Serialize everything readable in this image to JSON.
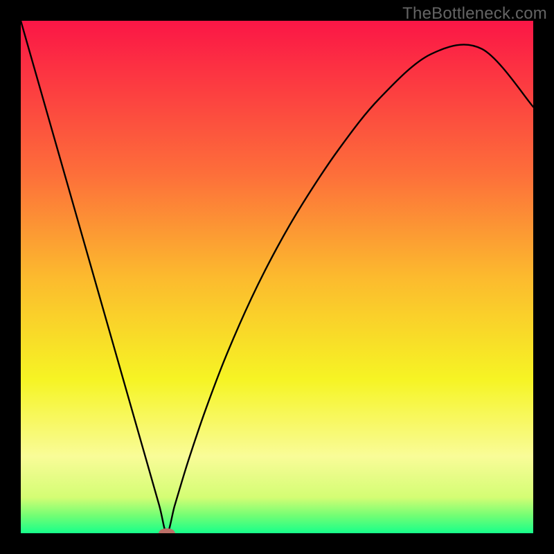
{
  "watermark": "TheBottleneck.com",
  "chart_data": {
    "type": "line",
    "title": "",
    "xlabel": "",
    "ylabel": "",
    "xlim": [
      0,
      100
    ],
    "ylim": [
      0,
      100
    ],
    "grid": false,
    "legend": false,
    "series": [
      {
        "name": "curve",
        "x": [
          0,
          3,
          6,
          9,
          12,
          15,
          18,
          21,
          24,
          27,
          28.5,
          30,
          31.5,
          33,
          36,
          40,
          45,
          50,
          55,
          62,
          70,
          80,
          90,
          100
        ],
        "y": [
          100,
          89.5,
          79,
          68.5,
          58,
          47.5,
          37,
          26.5,
          16,
          5.5,
          0,
          5.28,
          10.31,
          15.11,
          23.93,
          34.45,
          45.85,
          55.71,
          64.33,
          74.85,
          84.85,
          93.47,
          94.5,
          83.2
        ]
      }
    ],
    "marker": {
      "name": "bottleneck-point",
      "x": 28.5,
      "y": 0,
      "color": "#bc6f67"
    },
    "background": {
      "type": "vertical-gradient",
      "stops": [
        {
          "pos": 0.0,
          "color": "#fb1646"
        },
        {
          "pos": 0.3,
          "color": "#fd6f3a"
        },
        {
          "pos": 0.5,
          "color": "#fcba2e"
        },
        {
          "pos": 0.7,
          "color": "#f6f424"
        },
        {
          "pos": 0.85,
          "color": "#f9fc98"
        },
        {
          "pos": 0.93,
          "color": "#d4fd74"
        },
        {
          "pos": 0.965,
          "color": "#74fe74"
        },
        {
          "pos": 1.0,
          "color": "#17ff8a"
        }
      ]
    }
  }
}
